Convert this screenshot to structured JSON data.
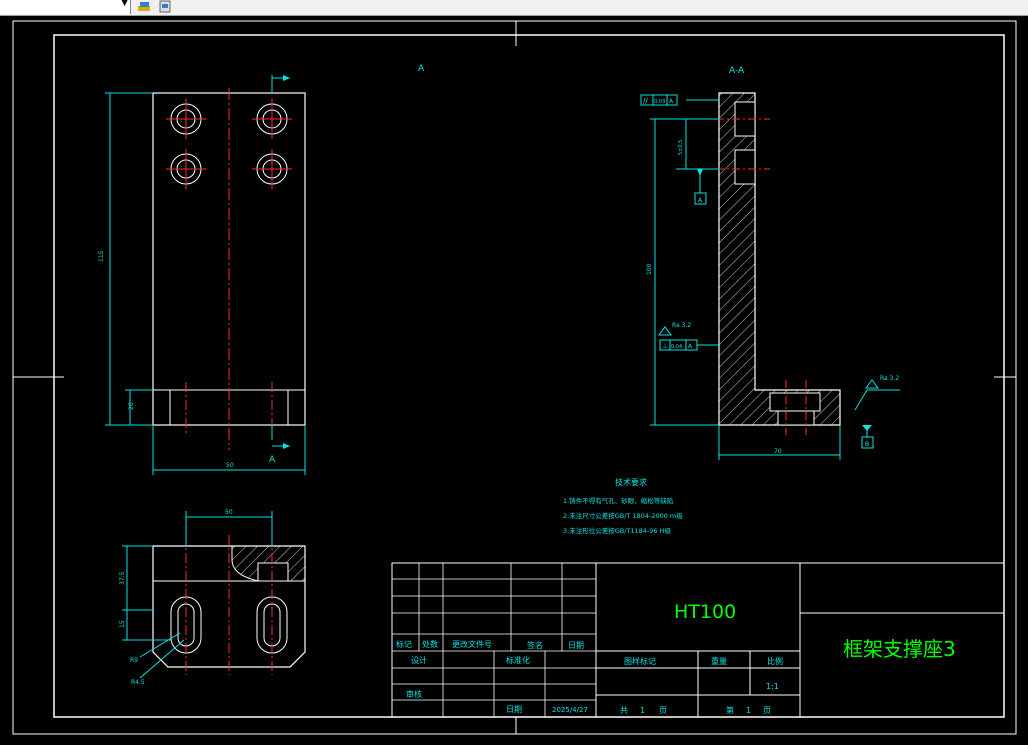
{
  "toolbar": {
    "icons": [
      "layer-properties-icon",
      "layer-states-icon"
    ]
  },
  "drawing": {
    "view_label_a": "A",
    "view_label_aa": "A-A",
    "section_arrow_label": "A",
    "dims": {
      "d115": "115",
      "d20": "20",
      "d50": "50",
      "d50b": "50",
      "d375": "37.5",
      "d15": "15",
      "r9": "R9",
      "r45": "R4.5",
      "d100": "100",
      "d70": "70",
      "d5": "5±0.5"
    },
    "gdt": {
      "par": "//",
      "tol1": "0.03",
      "datum_a": "A",
      "perp": "⊥",
      "tol2": "0.04",
      "datum_b": "B",
      "ra1": "Ra 3.2",
      "ra2": "Ra 3.2"
    },
    "tech": {
      "title": "技术要求",
      "l1": "1.铸件不得有气孔、砂眼、缩松等缺陷",
      "l2": "2.未注尺寸公差按GB/T 1804-2000 m级",
      "l3": "3.未注形位公差按GB/T1184-96 H级"
    }
  },
  "titleblock": {
    "material": "HT100",
    "part_name": "框架支撑座3",
    "biaoji": "标记",
    "chushu": "处数",
    "gengai": "更改文件号",
    "qianming": "签名",
    "riqi": "日期",
    "sheji": "设计",
    "biaozhunhua": "标准化",
    "shenhe": "审核",
    "riqi2": "日期",
    "date": "2025/4/27",
    "tuyang": "图样标记",
    "zhongliang": "重量",
    "bili": "比例",
    "scale": "1:1",
    "gong": "共",
    "gong_n": "1",
    "ye": "页",
    "di": "第",
    "di_n": "1",
    "ye2": "页"
  }
}
